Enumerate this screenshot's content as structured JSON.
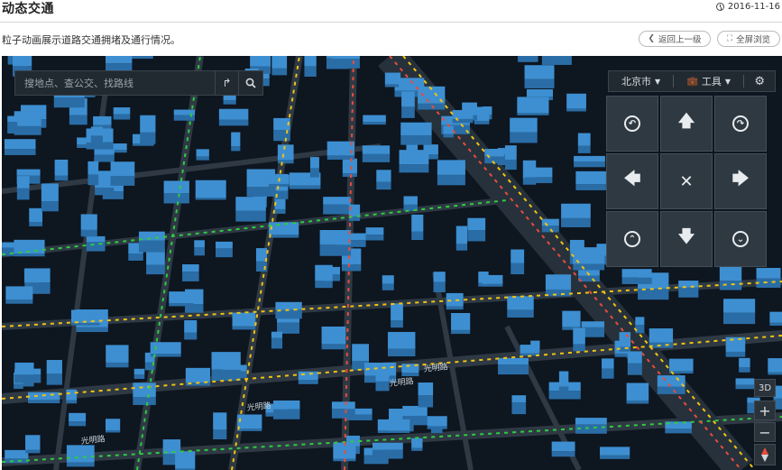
{
  "header": {
    "title": "动态交通",
    "date": "2016-11-16",
    "date_icon": "clock-icon"
  },
  "description": "粒子动画展示道路交通拥堵及通行情况。",
  "actions": {
    "back_label": "返回上一级",
    "back_icon": "chevron-left-icon",
    "fullscreen_label": "全屏浏览",
    "fullscreen_icon": "expand-icon"
  },
  "search": {
    "placeholder": "搜地点、查公交、找路线"
  },
  "toolbar": {
    "city_label": "北京市",
    "tools_label": "工具"
  },
  "map": {
    "roads": [
      {
        "label": "光明路",
        "id": "r1"
      },
      {
        "label": "光明路",
        "id": "r2"
      },
      {
        "label": "光明路",
        "id": "r3"
      },
      {
        "label": "光明路",
        "id": "r4"
      }
    ],
    "controls": {
      "mode_3d": "3D",
      "zoom_in": "+",
      "zoom_out": "−"
    }
  },
  "colors": {
    "map_bg": "#0e1620",
    "building": "#3d8fd1",
    "road": "#2b3640",
    "traffic_green": "#2ecc40",
    "traffic_yellow": "#f1c40f",
    "traffic_red": "#e74c3c"
  }
}
